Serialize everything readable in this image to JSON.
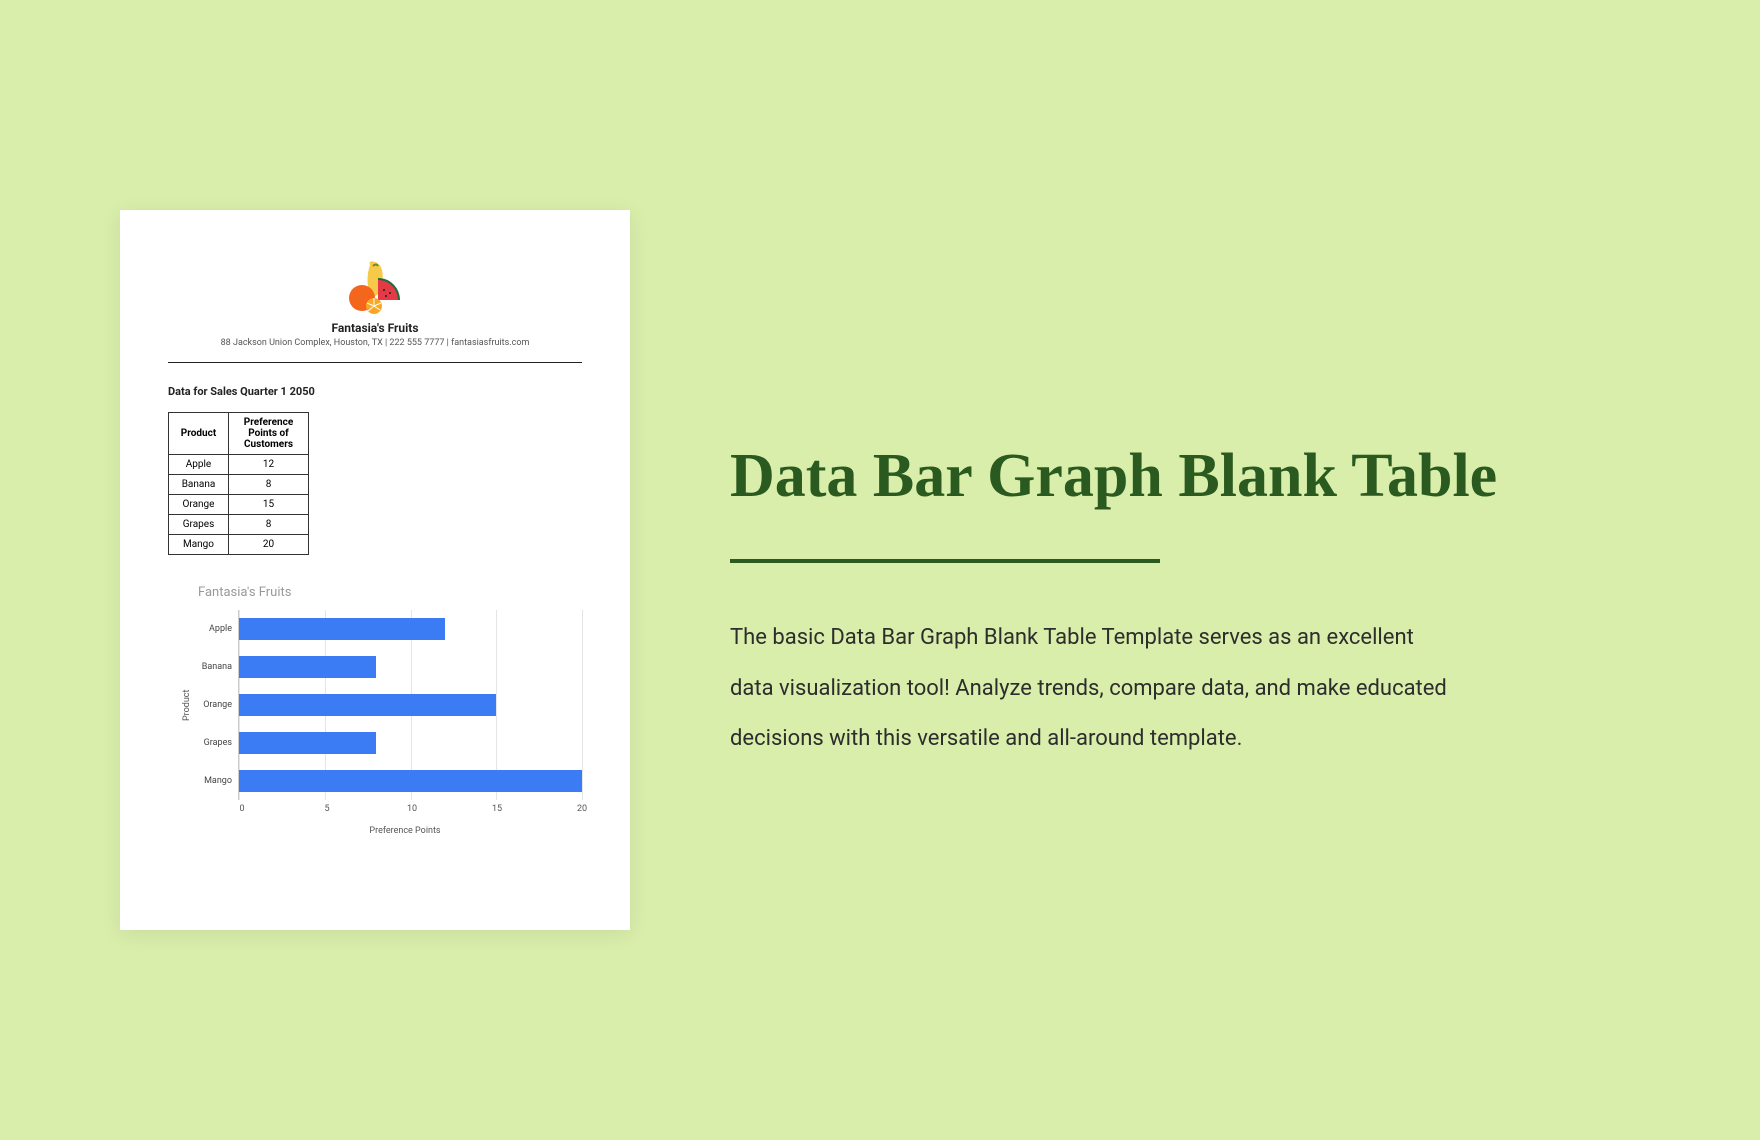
{
  "document": {
    "company_name": "Fantasia's Fruits",
    "company_address": "88 Jackson Union Complex, Houston, TX | 222 555 7777 | fantasiasfruits.com",
    "section_title": "Data for Sales Quarter 1 2050",
    "table": {
      "headers": [
        "Product",
        "Preference Points of Customers"
      ],
      "rows": [
        [
          "Apple",
          "12"
        ],
        [
          "Banana",
          "8"
        ],
        [
          "Orange",
          "15"
        ],
        [
          "Grapes",
          "8"
        ],
        [
          "Mango",
          "20"
        ]
      ]
    }
  },
  "chart_data": {
    "type": "bar",
    "orientation": "horizontal",
    "title": "Fantasia's Fruits",
    "categories": [
      "Apple",
      "Banana",
      "Orange",
      "Grapes",
      "Mango"
    ],
    "values": [
      12,
      8,
      15,
      8,
      20
    ],
    "xlabel": "Preference Points",
    "ylabel": "Product",
    "xlim": [
      0,
      20
    ],
    "xticks": [
      0,
      5,
      10,
      15,
      20
    ],
    "bar_color": "#3b7cf5"
  },
  "info": {
    "title": "Data Bar Graph Blank Table",
    "description": "The basic Data Bar Graph Blank Table Template serves as an excellent data visualization tool! Analyze trends, compare data, and make educated decisions with this versatile and all-around template."
  }
}
